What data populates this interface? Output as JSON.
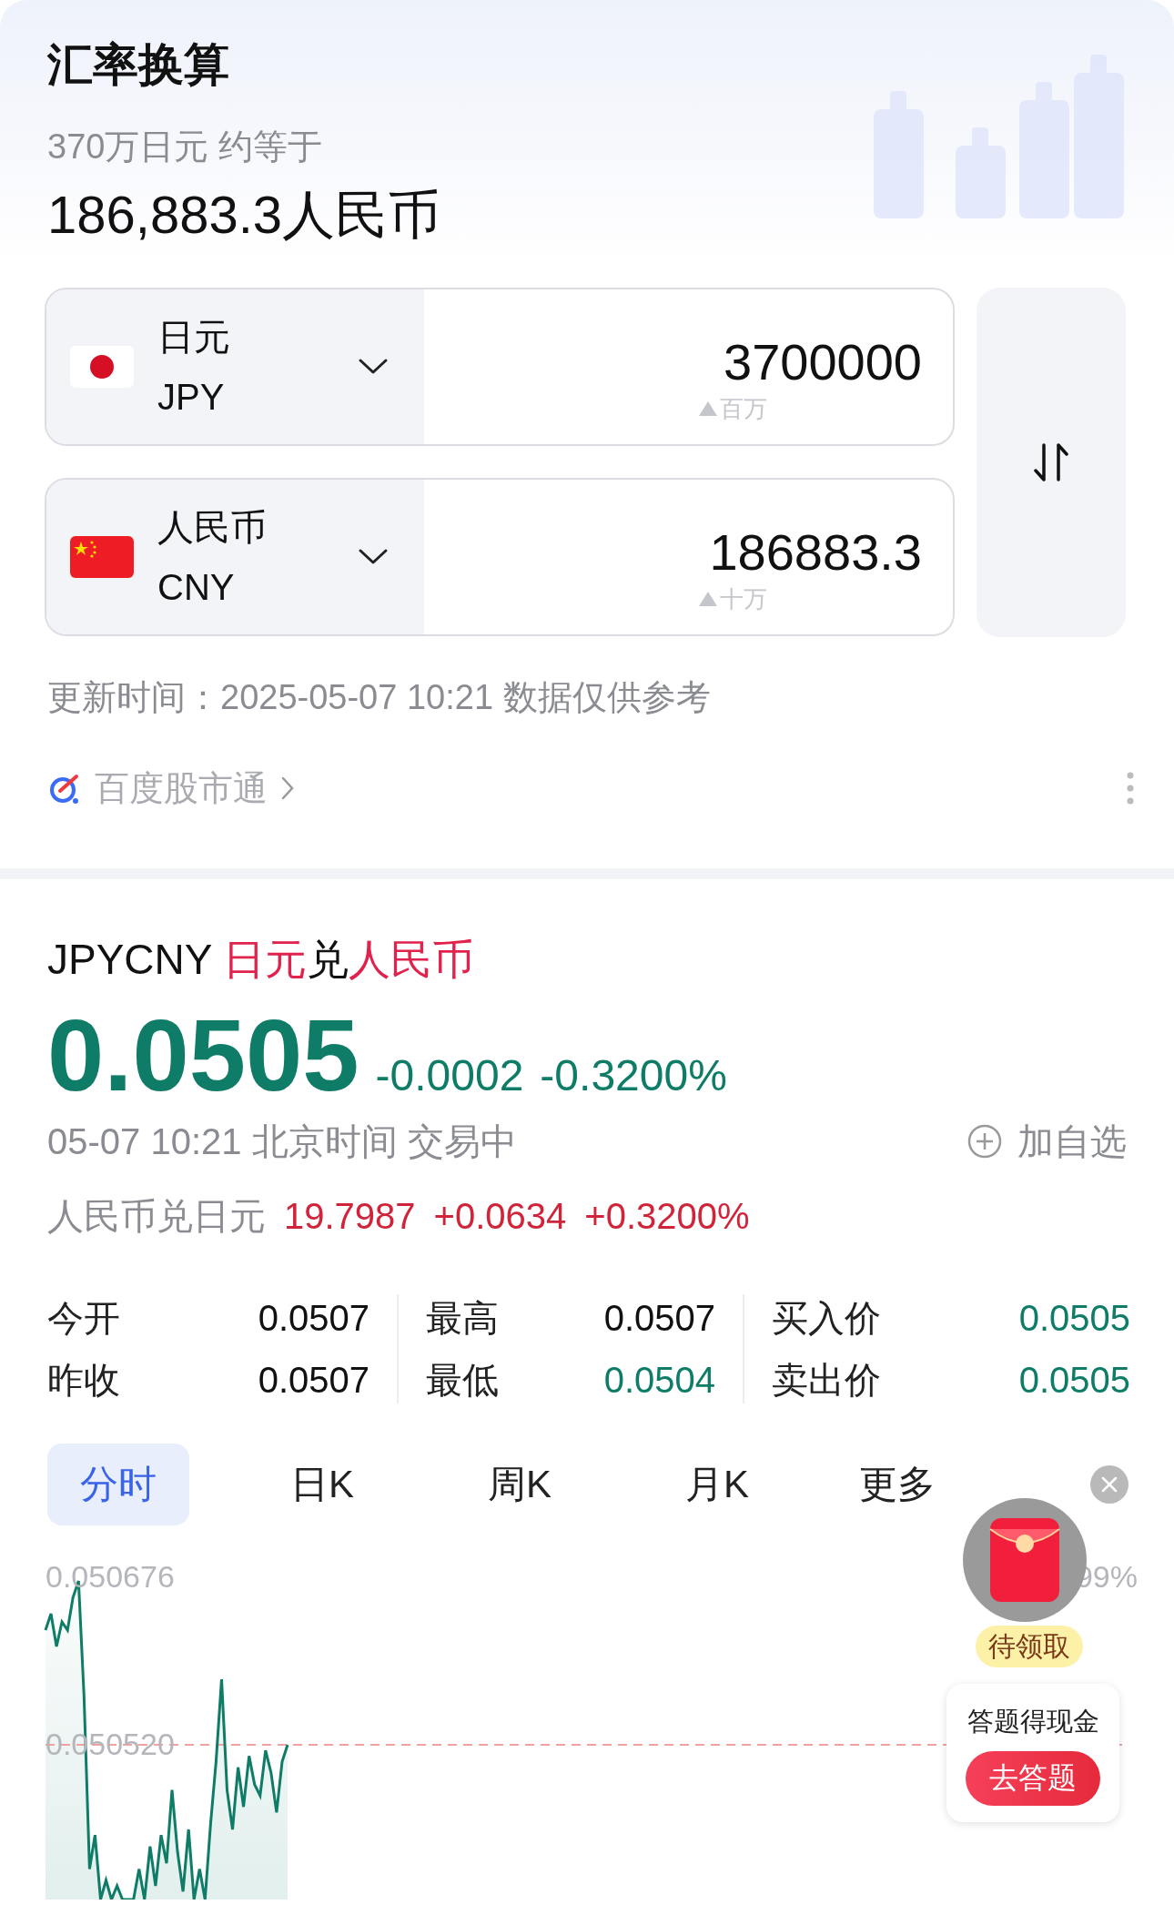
{
  "header": {
    "title": "汇率换算",
    "summary": "370万日元 约等于",
    "result": "186,883.3人民币"
  },
  "converter": {
    "rows": [
      {
        "name": "日元",
        "code": "JPY",
        "value": "3700000",
        "magnitude": "百万"
      },
      {
        "name": "人民币",
        "code": "CNY",
        "value": "186883.3",
        "magnitude": "十万"
      }
    ]
  },
  "update_note": "更新时间：2025-05-07 10:21 数据仅供参考",
  "source_link": "百度股市通",
  "quote": {
    "symbol": "JPYCNY",
    "pair": [
      {
        "text": "日元",
        "highlight": true
      },
      {
        "text": "兑",
        "highlight": false
      },
      {
        "text": "人民币",
        "highlight": true
      }
    ],
    "price": "0.0505",
    "change": "-0.0002",
    "change_pct": "-0.3200%",
    "color": "#0e7c66",
    "time_status": "05-07 10:21 北京时间 交易中",
    "watch_button": "加自选",
    "inverse": {
      "label": "人民币兑日元",
      "rate": "19.7987",
      "change": "+0.0634",
      "change_pct": "+0.3200%",
      "color": "#d0243a"
    }
  },
  "stats": [
    [
      {
        "label": "今开",
        "value": "0.0507",
        "color": "#111111"
      },
      {
        "label": "昨收",
        "value": "0.0507",
        "color": "#111111"
      }
    ],
    [
      {
        "label": "最高",
        "value": "0.0507",
        "color": "#111111"
      },
      {
        "label": "最低",
        "value": "0.0504",
        "color": "#0e7c66"
      }
    ],
    [
      {
        "label": "买入价",
        "value": "0.0505",
        "color": "#0e7c66"
      },
      {
        "label": "卖出价",
        "value": "0.0505",
        "color": "#0e7c66"
      }
    ]
  ],
  "tabs": [
    {
      "label": "分时",
      "selected": true
    },
    {
      "label": "日K",
      "selected": false
    },
    {
      "label": "周K",
      "selected": false
    },
    {
      "label": "月K",
      "selected": false
    },
    {
      "label": "更多",
      "selected": false
    }
  ],
  "chart": {
    "left_labels": [
      "0.050676",
      "0.050520"
    ],
    "right_label": "99%"
  },
  "promo": {
    "badge": "待领取",
    "card_text": "答题得现金",
    "card_button": "去答题"
  }
}
